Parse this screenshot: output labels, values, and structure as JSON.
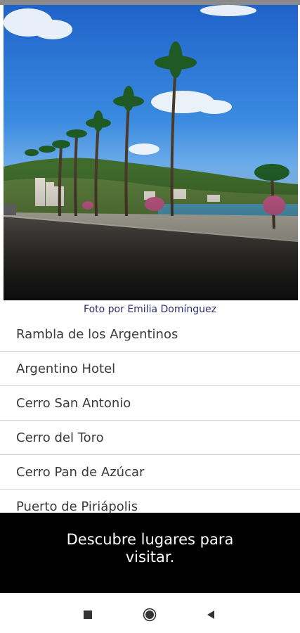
{
  "hero": {
    "alt": "Palm-lined coastal avenue under a blue sky",
    "caption": "Foto por Emilia  Domínguez"
  },
  "places": [
    "Rambla de los Argentinos",
    "Argentino Hotel",
    "Cerro San Antonio",
    "Cerro del Toro",
    "Cerro Pan de Azúcar",
    "Puerto de Piriápolis"
  ],
  "banner": {
    "text": "Descubre lugares para visitar."
  },
  "nav": {
    "recents_icon": "square-icon",
    "home_icon": "circle-icon",
    "back_icon": "back-triangle-icon"
  },
  "colors": {
    "caption": "#2a2e6a",
    "banner_bg": "#000000",
    "list_text": "#3a3a3a"
  }
}
